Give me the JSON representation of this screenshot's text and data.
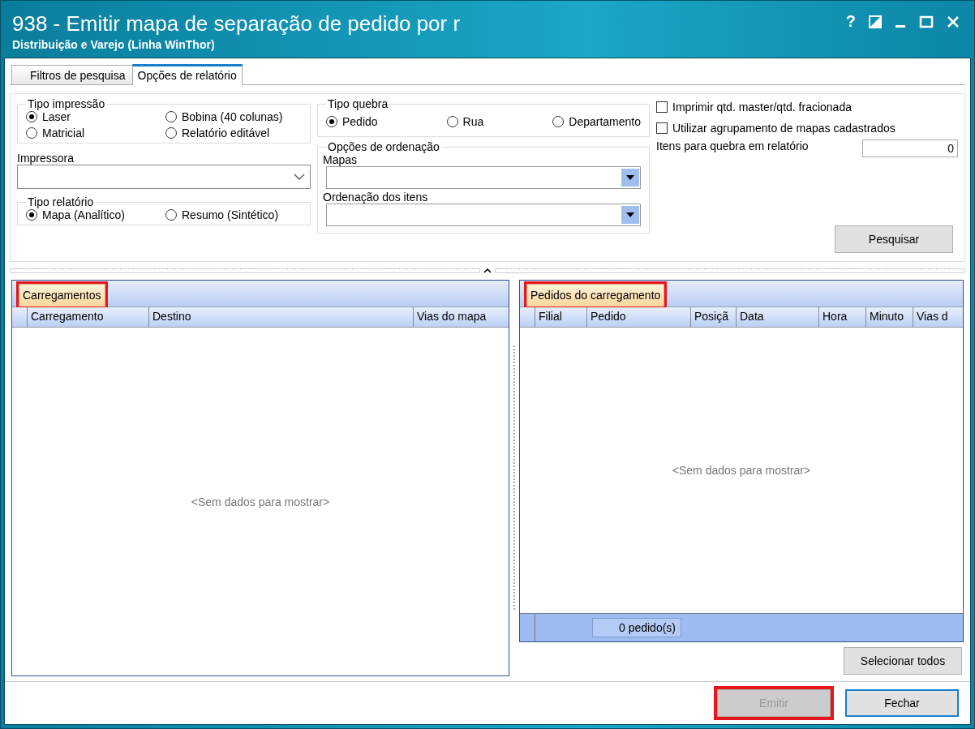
{
  "window": {
    "title": "938 - Emitir mapa de separação de pedido por r",
    "subtitle": "Distribuição e Varejo (Linha WinThor)",
    "help": "?"
  },
  "tabs": [
    {
      "label": "Filtros de pesquisa",
      "selected": false
    },
    {
      "label": "Opções de relatório",
      "selected": true
    }
  ],
  "tipo_impressao": {
    "title": "Tipo impressão",
    "options": [
      {
        "label": "Laser",
        "selected": true
      },
      {
        "label": "Bobina (40 colunas)",
        "selected": false
      },
      {
        "label": "Matricial",
        "selected": false
      },
      {
        "label": "Relatório editável",
        "selected": false
      }
    ]
  },
  "impressora": {
    "label": "Impressora"
  },
  "tipo_relatorio": {
    "title": "Tipo relatório",
    "options": [
      {
        "label": "Mapa (Analítico)",
        "selected": true
      },
      {
        "label": "Resumo (Sintético)",
        "selected": false
      }
    ]
  },
  "tipo_quebra": {
    "title": "Tipo quebra",
    "options": [
      {
        "label": "Pedido",
        "selected": true
      },
      {
        "label": "Rua",
        "selected": false
      },
      {
        "label": "Departamento",
        "selected": false
      }
    ]
  },
  "ordenacao": {
    "title": "Opções de ordenação",
    "fields": [
      {
        "label": "Mapas"
      },
      {
        "label": "Ordenação dos itens"
      }
    ]
  },
  "checks": [
    {
      "label": "Imprimir qtd. master/qtd. fracionada",
      "checked": false
    },
    {
      "label": "Utilizar agrupamento de mapas cadastrados",
      "checked": false
    }
  ],
  "itens_quebra": {
    "label": "Itens para quebra em relatório",
    "value": "0"
  },
  "search_button": "Pesquisar",
  "carregamentos": {
    "title": "Carregamentos",
    "highlighted": true,
    "columns": [
      "Carregamento",
      "Destino",
      "Vias do mapa"
    ],
    "empty_text": "<Sem dados para mostrar>"
  },
  "pedidos": {
    "title": "Pedidos do carregamento",
    "highlighted": true,
    "columns": [
      "Filial",
      "Pedido",
      "Posiçã",
      "Data",
      "Hora",
      "Minuto",
      "Vias d"
    ],
    "empty_text": "<Sem dados para mostrar>",
    "count": "0 pedido(s)"
  },
  "select_all_button": "Selecionar todos",
  "buttons": [
    {
      "label": "Emitir",
      "disabled": true,
      "highlighted": true,
      "default": false
    },
    {
      "label": "Fechar",
      "disabled": false,
      "highlighted": false,
      "default": true
    }
  ]
}
